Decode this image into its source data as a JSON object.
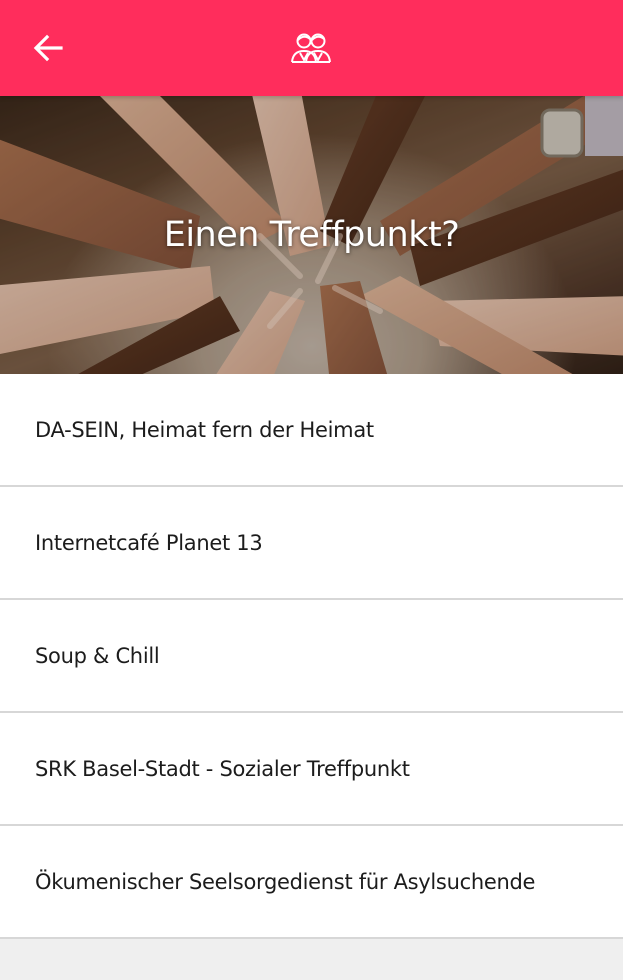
{
  "header": {
    "back_icon": "arrow-left-icon",
    "center_icon": "group-people-icon",
    "background": "#ff2d5c"
  },
  "hero": {
    "title": "Einen Treffpunkt?"
  },
  "list": {
    "items": [
      {
        "label": "DA-SEIN, Heimat fern der Heimat"
      },
      {
        "label": "Internetcafé Planet 13"
      },
      {
        "label": "Soup & Chill"
      },
      {
        "label": "SRK Basel-Stadt - Sozialer Treffpunkt"
      },
      {
        "label": "Ökumenischer Seelsorgedienst für Asylsuchende"
      }
    ]
  }
}
